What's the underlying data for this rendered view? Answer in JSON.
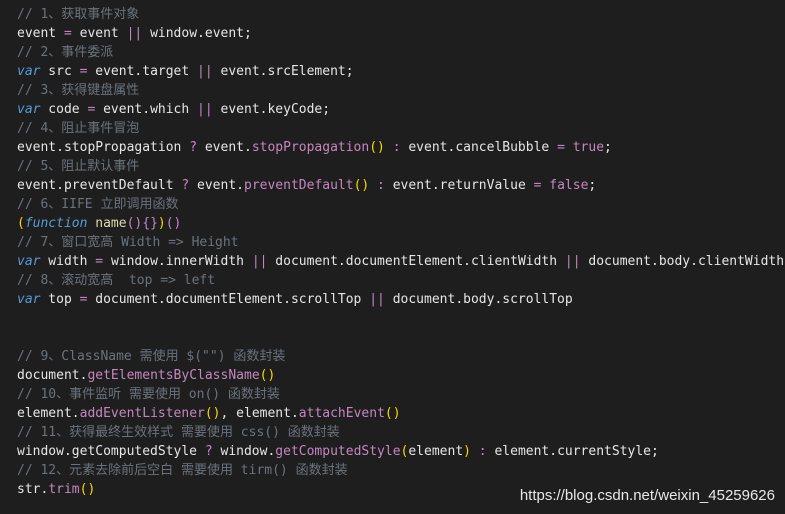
{
  "lines": [
    {
      "c": "// 1、获取事件对象"
    },
    {
      "p1": "event",
      "op1": " = ",
      "p2": "event ",
      "op2": "||",
      "p3": " window.event;"
    },
    {
      "c": "// 2、事件委派"
    },
    {
      "k": "var",
      "p1": " src",
      "op1": " = ",
      "p2": "event.target ",
      "op2": "||",
      "p3": " event.srcElement;"
    },
    {
      "c": "// 3、获得键盘属性"
    },
    {
      "k": "var",
      "p1": " code",
      "op1": " = ",
      "p2": "event.which ",
      "op2": "||",
      "p3": " event.keyCode;"
    },
    {
      "c": "// 4、阻止事件冒泡"
    },
    {
      "p1": "event.stopPropagation ",
      "op1": "?",
      "p2": " event.",
      "fn": "stopPropagation",
      "par": "()",
      "op2": " : ",
      "p3": "event.cancelBubble ",
      "op3": "=",
      "lit": " true",
      "p4": ";"
    },
    {
      "c": "// 5、阻止默认事件"
    },
    {
      "p1": "event.preventDefault ",
      "op1": "?",
      "p2": " event.",
      "fn": "preventDefault",
      "par": "()",
      "op2": " : ",
      "p3": "event.returnValue ",
      "op3": "=",
      "lit": " false",
      "p4": ";"
    },
    {
      "c": "// 6、IIFE 立即调用函数"
    },
    {
      "par1": "(",
      "k": "function",
      "p1": " ",
      "fy": "name",
      "par2": "(){}",
      "par3": ")",
      "par4": "()"
    },
    {
      "c": "// 7、窗口宽高 Width => Height"
    },
    {
      "k": "var",
      "p1": " width",
      "op1": " = ",
      "p2": "window.innerWidth ",
      "op2": "||",
      "p3": " document.documentElement.clientWidth ",
      "op3": "||",
      "p4": " document.body.clientWidth;"
    },
    {
      "c": "// 8、滚动宽高  top => left"
    },
    {
      "k": "var",
      "p1": " top",
      "op1": " = ",
      "p2": "document.documentElement.scrollTop ",
      "op2": "||",
      "p3": " document.body.scrollTop"
    },
    {
      "blank": ""
    },
    {
      "blank": ""
    },
    {
      "c": "// 9、ClassName 需使用 $(\"\") 函数封装"
    },
    {
      "p1": "document.",
      "fn": "getElementsByClassName",
      "par": "()"
    },
    {
      "c": "// 10、事件监听 需要使用 on() 函数封装"
    },
    {
      "p1": "element.",
      "fn": "addEventListener",
      "par": "()",
      "p2": ", element.",
      "fn2": "attachEvent",
      "par2": "()"
    },
    {
      "c": "// 11、获得最终生效样式 需要使用 css() 函数封装"
    },
    {
      "p1": "window.getComputedStyle ",
      "op1": "?",
      "p2": " window.",
      "fn": "getComputedStyle",
      "par": "(",
      "p3": "element",
      "par2": ")",
      "op2": " : ",
      "p4": "element.currentStyle;"
    },
    {
      "c": "// 12、元素去除前后空白 需要使用 tirm() 函数封装"
    },
    {
      "p1": "str.",
      "fn": "trim",
      "par": "()"
    }
  ],
  "watermark": "https://blog.csdn.net/weixin_45259626"
}
